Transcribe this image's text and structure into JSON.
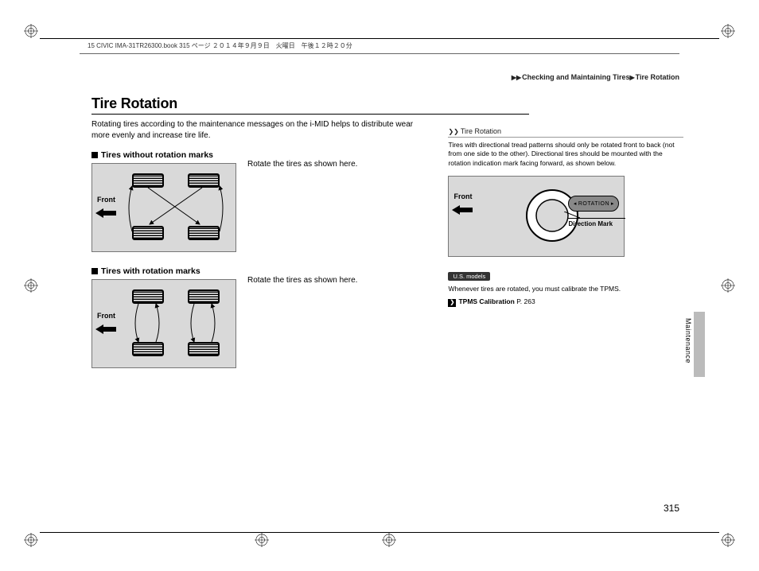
{
  "header": {
    "meta": "15 CIVIC IMA-31TR26300.book  315 ページ  ２０１４年９月９日　火曜日　午後１２時２０分"
  },
  "breadcrumb": {
    "arrow": "▶▶",
    "part1": "Checking and Maintaining Tires",
    "sep": "▶",
    "part2": "Tire Rotation"
  },
  "title": "Tire Rotation",
  "intro": "Rotating tires according to the maintenance messages on the i-MID helps to distribute wear more evenly and increase tire life.",
  "section1": {
    "heading": "Tires without rotation marks",
    "instruction": "Rotate the tires as shown here.",
    "front": "Front"
  },
  "section2": {
    "heading": "Tires with rotation marks",
    "instruction": "Rotate the tires as shown here.",
    "front": "Front"
  },
  "side": {
    "heading_icon": "❯❯",
    "heading": "Tire Rotation",
    "text": "Tires with directional tread patterns should only be rotated front to back (not from one side to the other). Directional tires should be mounted with the rotation indication mark facing forward, as shown below.",
    "front": "Front",
    "rotation_label": "ROTATION",
    "direction_mark": "Direction Mark",
    "us_badge": "U.S. models",
    "tpms_text": "Whenever tires are rotated, you must calibrate the TPMS.",
    "tpms_ref_icon": "❯",
    "tpms_ref": "TPMS Calibration",
    "tpms_page": "P. 263"
  },
  "tab": "Maintenance",
  "page_number": "315"
}
